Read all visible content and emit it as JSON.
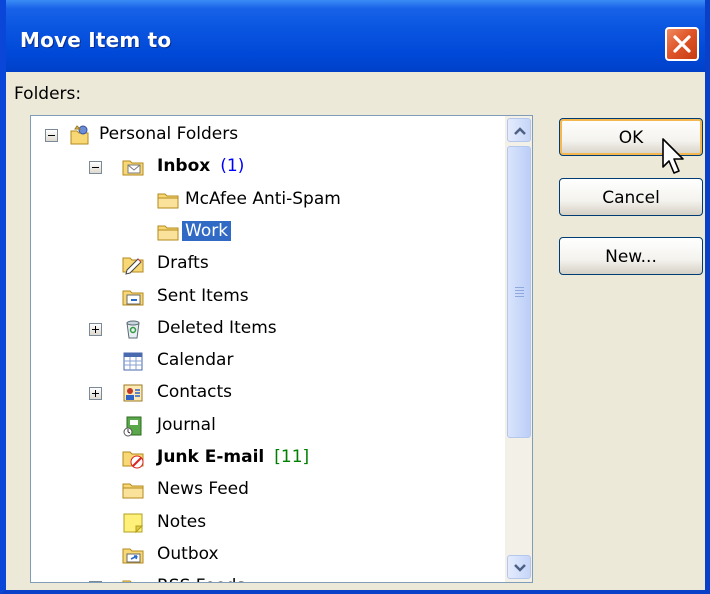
{
  "window": {
    "title": "Move Item to",
    "colors": {
      "titlebar": "#0A55E0",
      "dialog_bg": "#ECE9D8",
      "selection": "#316AC5",
      "unread_blue": "#0000FF",
      "junk_green": "#008000"
    }
  },
  "folders_label": "Folders:",
  "tree": [
    {
      "label": "Personal Folders",
      "icon": "personal-folders-icon",
      "expander": "minus"
    },
    {
      "label": "Inbox",
      "count": "(1)",
      "icon": "inbox-icon",
      "expander": "minus",
      "bold": true
    },
    {
      "label": "McAfee Anti-Spam",
      "icon": "folder-icon"
    },
    {
      "label": "Work",
      "icon": "folder-icon",
      "selected": true
    },
    {
      "label": "Drafts",
      "icon": "drafts-icon"
    },
    {
      "label": "Sent Items",
      "icon": "sent-items-icon"
    },
    {
      "label": "Deleted Items",
      "icon": "deleted-items-icon",
      "expander": "plus"
    },
    {
      "label": "Calendar",
      "icon": "calendar-icon"
    },
    {
      "label": "Contacts",
      "icon": "contacts-icon",
      "expander": "plus"
    },
    {
      "label": "Journal",
      "icon": "journal-icon"
    },
    {
      "label": "Junk E-mail",
      "count": "[11]",
      "icon": "junk-email-icon",
      "bold": true
    },
    {
      "label": "News Feed",
      "icon": "folder-icon"
    },
    {
      "label": "Notes",
      "icon": "notes-icon"
    },
    {
      "label": "Outbox",
      "icon": "outbox-icon"
    },
    {
      "label": "RSS Feeds",
      "icon": "rss-feeds-icon",
      "expander": "plus"
    }
  ],
  "buttons": {
    "ok": "OK",
    "cancel": "Cancel",
    "new": "New..."
  }
}
